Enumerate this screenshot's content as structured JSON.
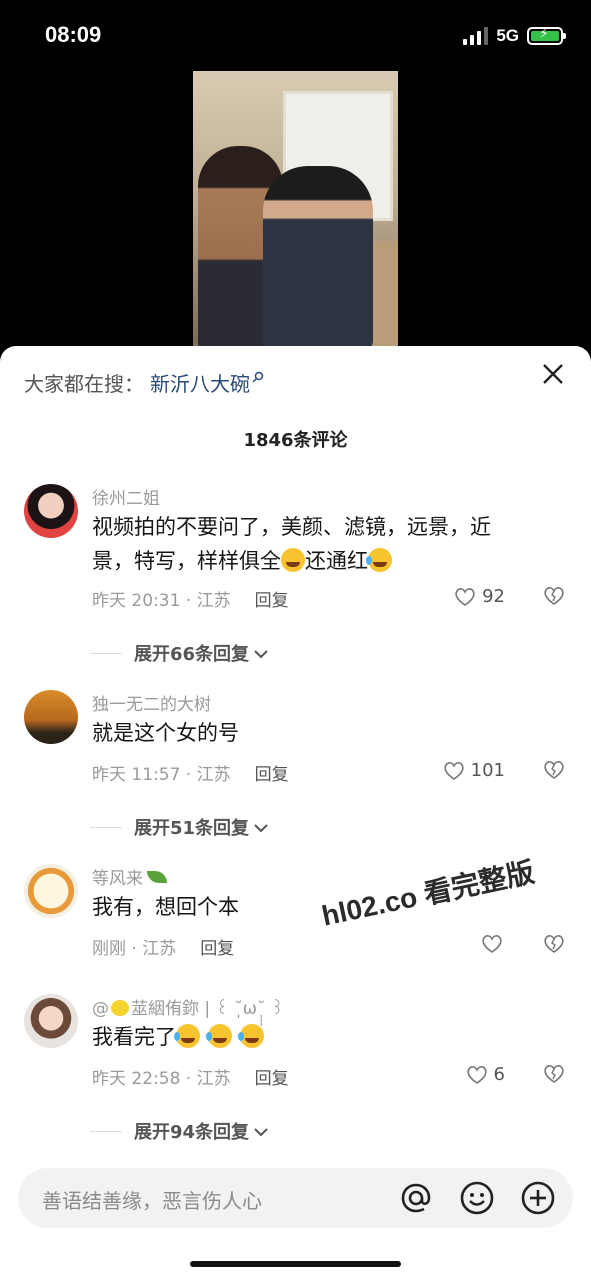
{
  "status_bar": {
    "time": "08:09",
    "network": "5G"
  },
  "search_hint": {
    "label": "大家都在搜：",
    "term": "新沂八大碗"
  },
  "comments_header": {
    "count_label": "1846条评论"
  },
  "comments": [
    {
      "name": "徐州二姐",
      "text_line1": "视频拍的不要问了，美颜、滤镜，远景，近",
      "text_line2a": "景，特写，样样俱全",
      "text_line2b": "还通红",
      "time": "昨天 20:31 · 江苏",
      "reply": "回复",
      "likes": "92",
      "expand": "展开66条回复"
    },
    {
      "name": "独一无二的大树",
      "text": "就是这个女的号",
      "time": "昨天 11:57 · 江苏",
      "reply": "回复",
      "likes": "101",
      "expand": "展开51条回复"
    },
    {
      "name": "等风来",
      "text": "我有，想回个本",
      "time": "刚刚 · 江苏",
      "reply": "回复",
      "likes": ""
    },
    {
      "name_prefix": "@",
      "name": "莁絪侑鉨 | ꒰ ˘̩̩̩ω˘̩̩̩ ꒱",
      "text": "我看完了",
      "time": "昨天 22:58 · 江苏",
      "reply": "回复",
      "likes": "6",
      "expand": "展开94条回复"
    }
  ],
  "watermark": "hl02.co 看完整版",
  "input": {
    "placeholder": "善语结善缘，恶言伤人心"
  },
  "colors": {
    "link": "#2a4a79",
    "battery": "#33c14a",
    "meta": "#9a9a9a"
  }
}
